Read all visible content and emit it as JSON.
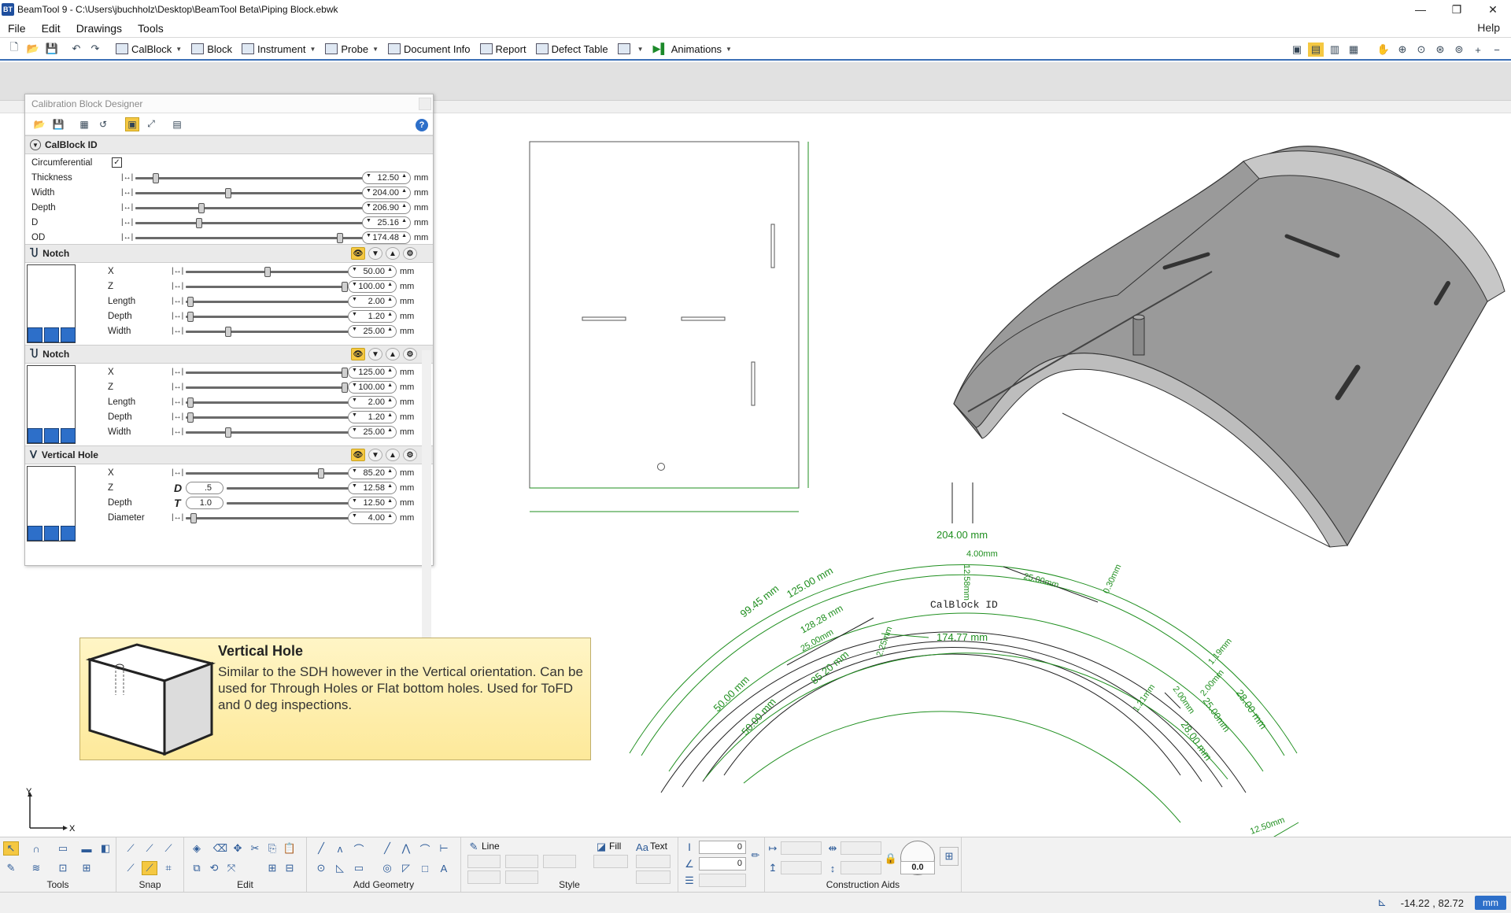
{
  "window": {
    "title": "BeamTool 9 - C:\\Users\\jbuchholz\\Desktop\\BeamTool Beta\\Piping Block.ebwk",
    "logo": "BT"
  },
  "menu": [
    "File",
    "Edit",
    "Drawings",
    "Tools"
  ],
  "menu_help": "Help",
  "toolbar": {
    "calblock": "CalBlock",
    "block": "Block",
    "instrument": "Instrument",
    "probe": "Probe",
    "document_info": "Document Info",
    "report": "Report",
    "defect_table": "Defect Table",
    "animations": "Animations"
  },
  "designer": {
    "title": "Calibration Block Designer",
    "help": "?",
    "calblock": {
      "header": "CalBlock ID",
      "circumferential_label": "Circumferential",
      "circumferential_checked": true,
      "rows": [
        {
          "label": "Thickness",
          "value": "12.50",
          "unit": "mm",
          "slider": 0.07
        },
        {
          "label": "Width",
          "value": "204.00",
          "unit": "mm",
          "slider": 0.37
        },
        {
          "label": "Depth",
          "value": "206.90",
          "unit": "mm",
          "slider": 0.26
        },
        {
          "label": "D",
          "value": "25.16",
          "unit": "mm",
          "slider": 0.25
        },
        {
          "label": "OD",
          "value": "174.48",
          "unit": "mm",
          "slider": 0.83
        }
      ]
    },
    "notch1": {
      "header": "Notch",
      "rows": [
        {
          "label": "X",
          "value": "50.00",
          "unit": "mm",
          "slider": 0.5
        },
        {
          "label": "Z",
          "value": "100.00",
          "unit": "mm",
          "slider": 0.99
        },
        {
          "label": "Length",
          "value": "2.00",
          "unit": "mm",
          "slider": 0.01
        },
        {
          "label": "Depth",
          "value": "1.20",
          "unit": "mm",
          "slider": 0.01
        },
        {
          "label": "Width",
          "value": "25.00",
          "unit": "mm",
          "slider": 0.25
        }
      ]
    },
    "notch2": {
      "header": "Notch",
      "rows": [
        {
          "label": "X",
          "value": "125.00",
          "unit": "mm",
          "slider": 0.99
        },
        {
          "label": "Z",
          "value": "100.00",
          "unit": "mm",
          "slider": 0.99
        },
        {
          "label": "Length",
          "value": "2.00",
          "unit": "mm",
          "slider": 0.01
        },
        {
          "label": "Depth",
          "value": "1.20",
          "unit": "mm",
          "slider": 0.01
        },
        {
          "label": "Width",
          "value": "25.00",
          "unit": "mm",
          "slider": 0.25
        }
      ]
    },
    "vhole": {
      "header": "Vertical Hole",
      "rows": [
        {
          "label": "X",
          "value": "85.20",
          "unit": "mm",
          "slider": 0.84
        },
        {
          "label": "Z",
          "value": "12.58",
          "unit": "mm",
          "sub_label": "D",
          "sub_value": ".5"
        },
        {
          "label": "Depth",
          "value": "12.50",
          "unit": "mm",
          "sub_label": "T",
          "sub_value": "1.0"
        },
        {
          "label": "Diameter",
          "value": "4.00",
          "unit": "mm",
          "slider": 0.03
        }
      ]
    }
  },
  "tooltip": {
    "title": "Vertical Hole",
    "text": "Similar to the SDH however in the Vertical orientation. Can be used for Through Holes or Flat bottom holes. Used for ToFD and 0 deg inspections."
  },
  "drawing": {
    "block_label": "CalBlock ID",
    "dim_width": "204.00 mm",
    "dim_inner": "174.77 mm",
    "dim_a": "99.45 mm",
    "dim_b": "125.00 mm",
    "dim_c": "128.28 mm",
    "dim_d": "25.00mm",
    "dim_e": "50.00 mm",
    "dim_f": "85.20 mm",
    "dim_g": "50.00 mm",
    "dim_h": "4.00mm",
    "dim_i": "12.58mm",
    "dim_j": "25.00mm",
    "dim_k": "0.30mm",
    "dim_l": "2.25mm",
    "dim_m": "1.19mm",
    "dim_n": "2.00mm",
    "dim_o": "2.00mm",
    "dim_p": "1.21mm",
    "dim_q": "25.00mm",
    "dim_r": "28.00 mm",
    "dim_s": "28.00 mm",
    "dim_t": "12.50mm",
    "axis_x": "X",
    "axis_y": "Y"
  },
  "ribbon": {
    "tools": "Tools",
    "snap": "Snap",
    "edit": "Edit",
    "add_geometry": "Add Geometry",
    "line": "Line",
    "fill": "Fill",
    "text": "Text",
    "style": "Style",
    "construction_aids": "Construction Aids",
    "field1": "0",
    "field2": "0",
    "angle": "0.0"
  },
  "status": {
    "coords": "-14.22 , 82.72",
    "unit": "mm"
  },
  "colors": {
    "accent": "#2d6fc9",
    "highlight": "#f5c842",
    "dimension": "#1f8f1f",
    "tooltip_bg": "#fde99a"
  }
}
